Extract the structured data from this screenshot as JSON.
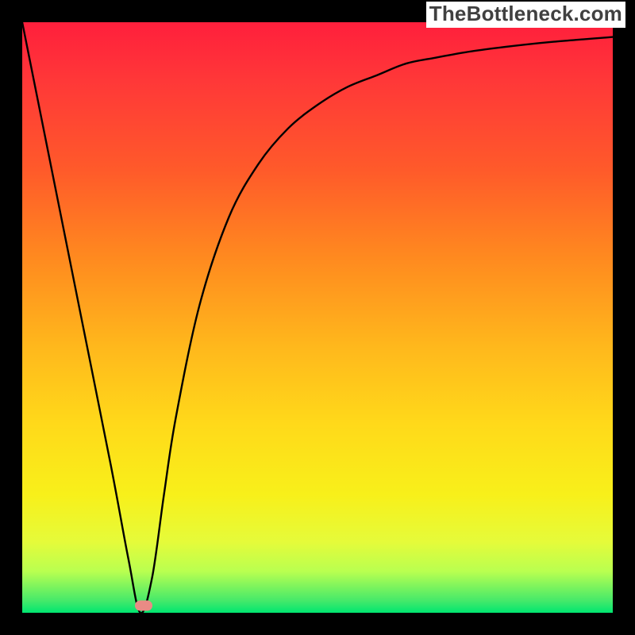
{
  "branding": {
    "text": "TheBottleneck.com"
  },
  "chart_data": {
    "type": "line",
    "title": "",
    "xlabel": "",
    "ylabel": "",
    "xlim": [
      0,
      100
    ],
    "ylim": [
      0,
      100
    ],
    "grid": false,
    "series": [
      {
        "name": "curve",
        "x": [
          0,
          5,
          10,
          15,
          18,
          20,
          22,
          24,
          26,
          30,
          35,
          40,
          45,
          50,
          55,
          60,
          65,
          70,
          75,
          80,
          85,
          90,
          95,
          100
        ],
        "values": [
          100,
          75,
          50,
          25,
          9,
          0,
          6,
          20,
          33,
          52,
          67,
          76,
          82,
          86,
          89,
          91,
          93,
          94.0,
          94.9,
          95.6,
          96.2,
          96.7,
          97.1,
          97.5
        ]
      }
    ],
    "marker": {
      "x": 20.5,
      "y": 1.2
    },
    "background_gradient": {
      "stops": [
        {
          "pos": 0,
          "color": "#ff1f3c"
        },
        {
          "pos": 25,
          "color": "#ff5a2a"
        },
        {
          "pos": 55,
          "color": "#ffb81c"
        },
        {
          "pos": 80,
          "color": "#f8f01a"
        },
        {
          "pos": 100,
          "color": "#00e670"
        }
      ]
    }
  }
}
